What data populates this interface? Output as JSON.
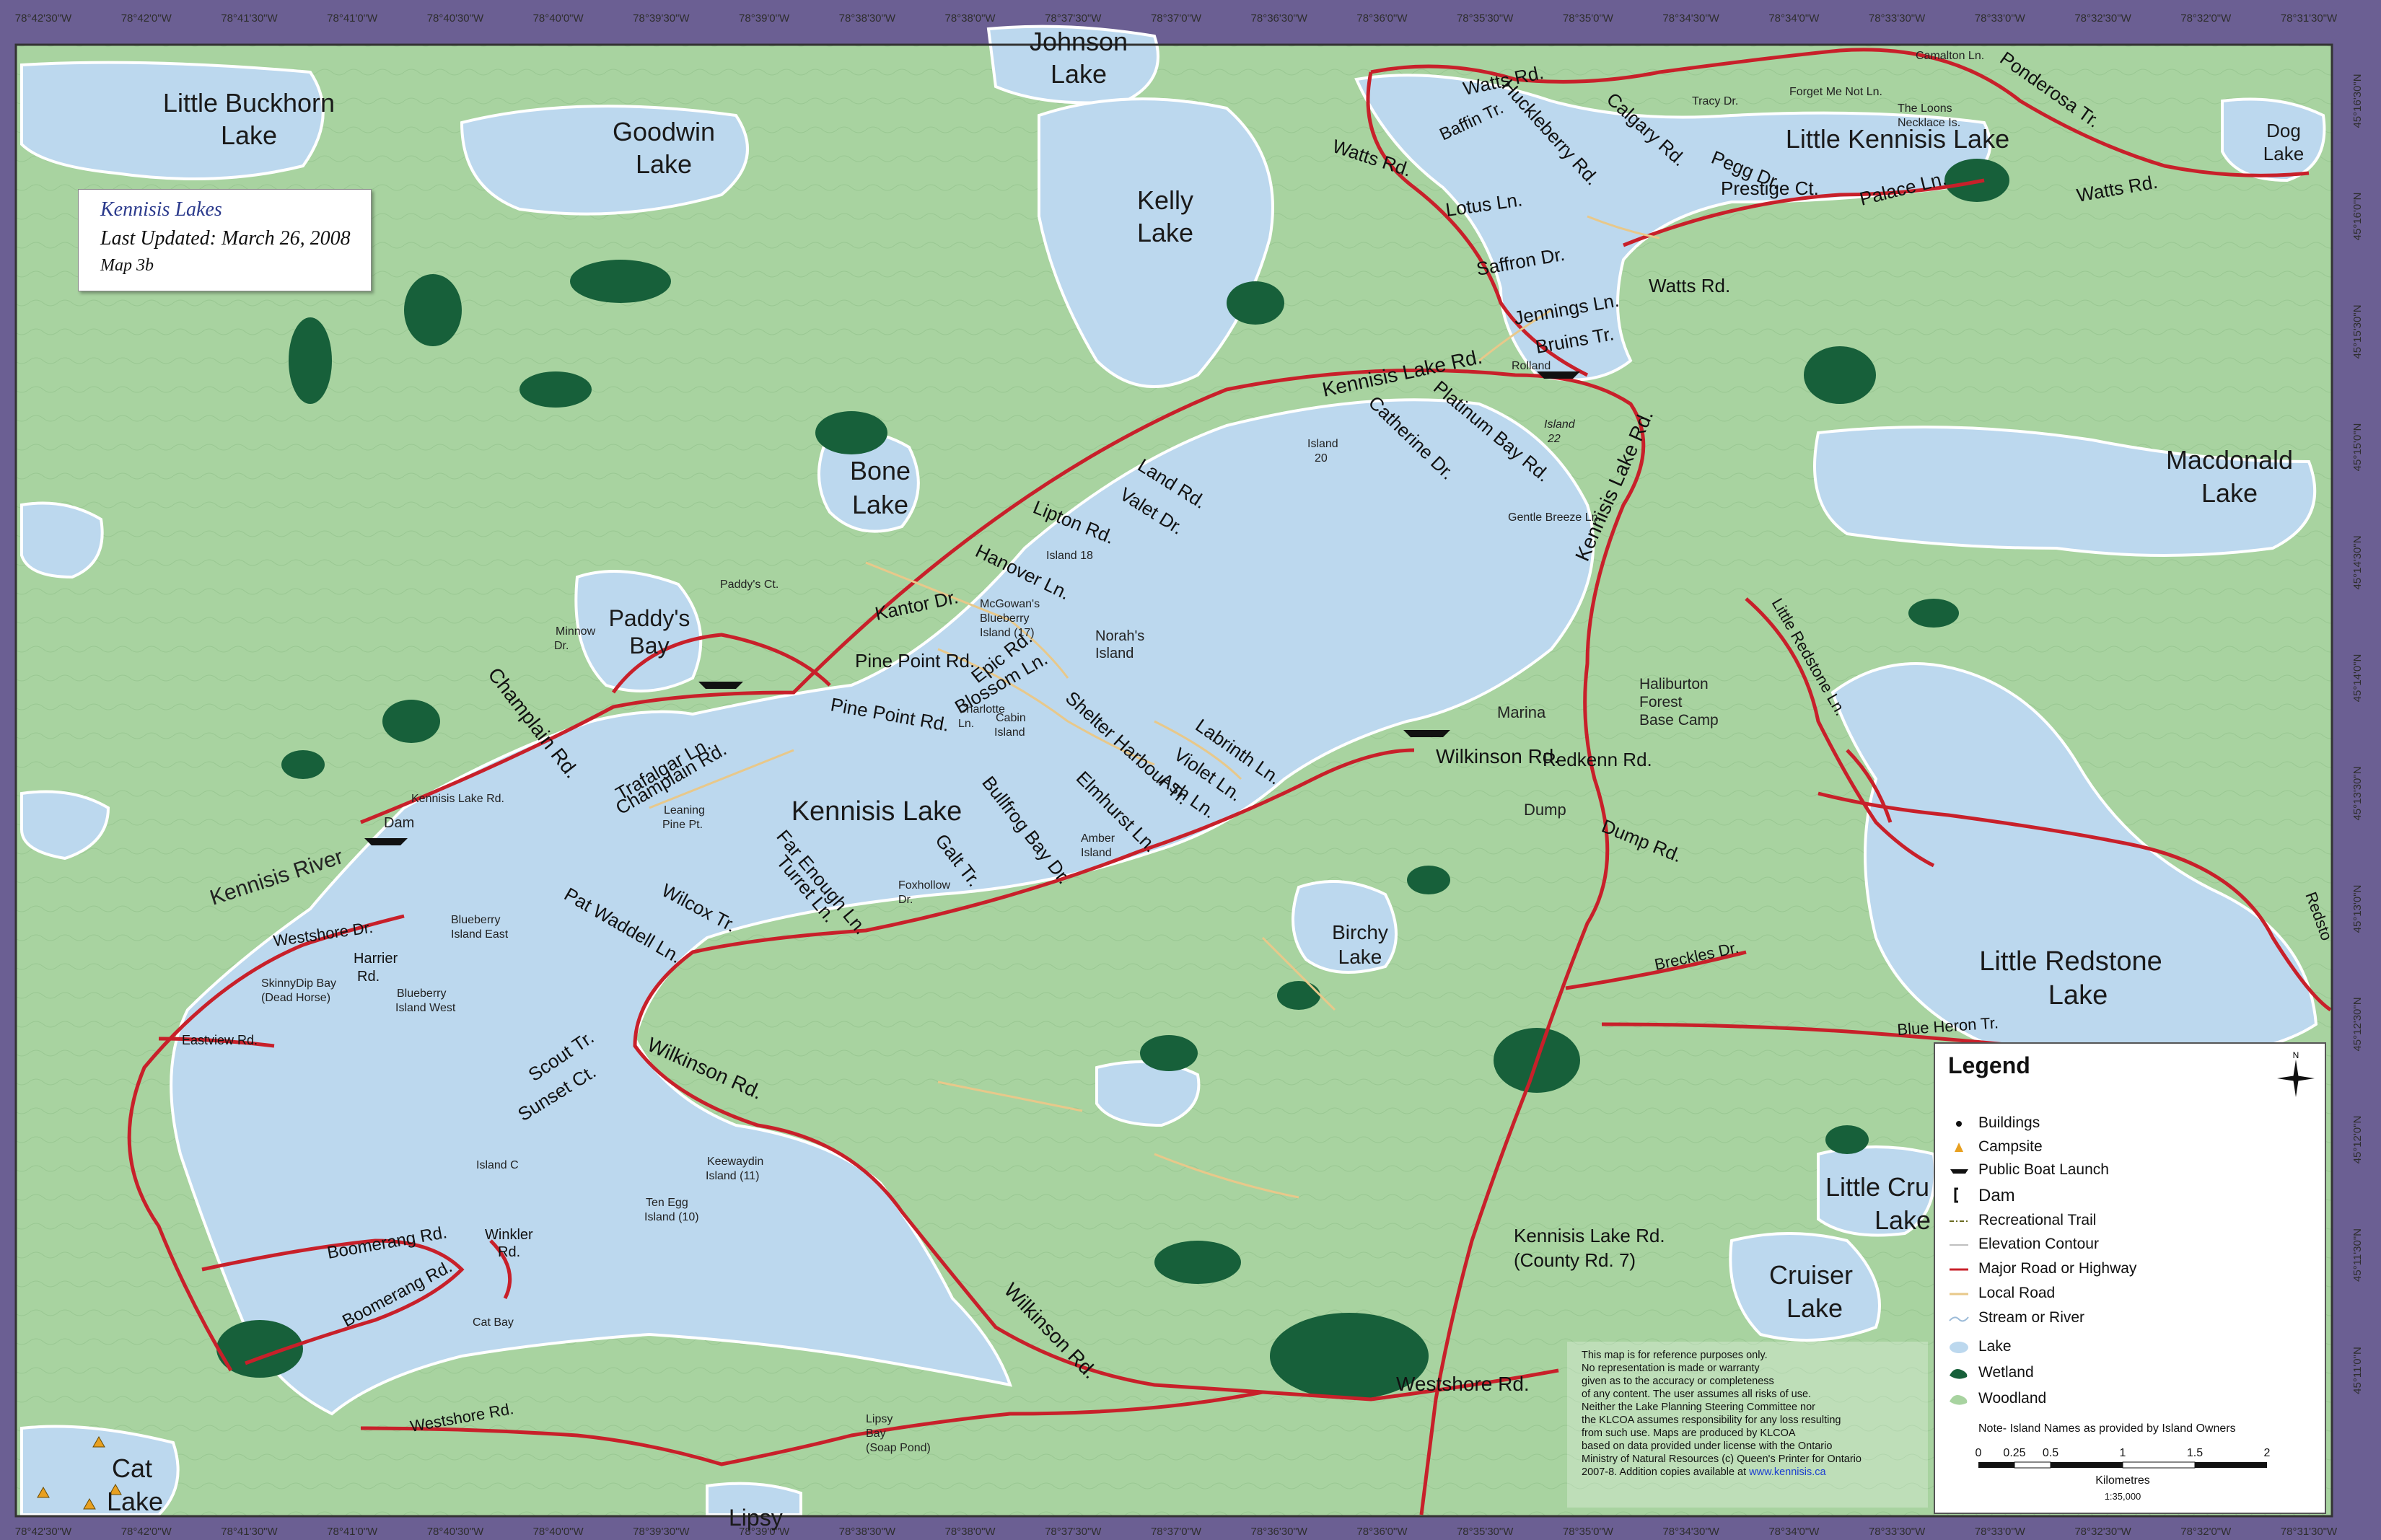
{
  "title_box": {
    "title": "Kennisis Lakes",
    "updated": "Last Updated: March 26, 2008",
    "map_no": "Map 3b"
  },
  "top_coords": [
    "78°42'30\"W",
    "78°42'0\"W",
    "78°41'30\"W",
    "78°41'0\"W",
    "78°40'30\"W",
    "78°40'0\"W",
    "78°39'30\"W",
    "78°39'0\"W",
    "78°38'30\"W",
    "78°38'0\"W",
    "78°37'30\"W",
    "78°37'0\"W",
    "78°36'30\"W",
    "78°36'0\"W",
    "78°35'30\"W",
    "78°35'0\"W",
    "78°34'30\"W",
    "78°34'0\"W",
    "78°33'30\"W",
    "78°33'0\"W",
    "78°32'30\"W",
    "78°32'0\"W",
    "78°31'30\"W"
  ],
  "right_coords": [
    "45°16'30\"N",
    "45°16'0\"N",
    "45°15'30\"N",
    "45°15'0\"N",
    "45°14'30\"N",
    "45°14'0\"N",
    "45°13'30\"N",
    "45°13'0\"N",
    "45°12'30\"N",
    "45°12'0\"N",
    "45°11'30\"N",
    "45°11'0\"N"
  ],
  "lakes": {
    "little_buckhorn": [
      "Little Buckhorn",
      "Lake"
    ],
    "goodwin": [
      "Goodwin",
      "Lake"
    ],
    "johnson": [
      "Johnson",
      "Lake"
    ],
    "kelly": [
      "Kelly",
      "Lake"
    ],
    "bone": [
      "Bone",
      "Lake"
    ],
    "paddys_bay": [
      "Paddy's",
      "Bay"
    ],
    "kennisis": "Kennisis Lake",
    "little_kennisis": "Little Kennisis Lake",
    "dog": [
      "Dog",
      "Lake"
    ],
    "macdonald": [
      "Macdonald",
      "Lake"
    ],
    "little_redstone": [
      "Little Redstone",
      "Lake"
    ],
    "birchy": [
      "Birchy",
      "Lake"
    ],
    "cruiser": [
      "Cruiser",
      "Lake"
    ],
    "little_cruiser": [
      "Little Cru",
      "Lake"
    ],
    "cat": [
      "Cat",
      "Lake"
    ],
    "lipsy": "Lipsy"
  },
  "roads": {
    "watts1": "Watts Rd.",
    "watts2": "Watts Rd.",
    "watts3": "Watts Rd.",
    "watts4": "Watts Rd.",
    "huckleberry": "Huckleberry Rd.",
    "calgary": "Calgary Rd.",
    "baffin": "Baffin Tr.",
    "pegg": "Pegg Dr.",
    "prestige": "Prestige Ct.",
    "palace": "Palace Ln.",
    "ponderosa": "Ponderosa Tr.",
    "lotus": "Lotus Ln.",
    "saffron": "Saffron Dr.",
    "jennings": "Jennings Ln.",
    "bruins": "Bruins Tr.",
    "kennisis_lake_rd": "Kennisis Lake Rd.",
    "kennisis_lake_rd2": "Kennisis Lake Rd.",
    "platinum": "Platinum Bay Rd.",
    "catherine": "Catherine Dr.",
    "land": "Land Rd.",
    "valet": "Valet Dr.",
    "lipton": "Lipton Rd.",
    "hanover": "Hanover Ln.",
    "kantor": "Kantor Dr.",
    "pine_point1": "Pine Point Rd.",
    "pine_point2": "Pine Point Rd.",
    "epic": "Epic Rd.",
    "blossom": "Blossom Ln.",
    "shelter": "Shelter Harbour Tr.",
    "labrinth": "Labrinth Ln.",
    "violet": "Violet Ln.",
    "ash": "Ash Ln.",
    "elmhurst": "Elmhurst Ln.",
    "wilkinson1": "Wilkinson Rd.",
    "wilkinson2": "Wilkinson Rd.",
    "wilkinson3": "Wilkinson Rd.",
    "redkenn": "Redkenn Rd.",
    "dump_rd": "Dump Rd.",
    "champlain1": "Champlain Rd.",
    "champlain2": "Champlain Rd.",
    "trafalgar": "Trafalgar Ln.",
    "bullfrog": "Bullfrog Bay Dr.",
    "galt": "Galt Tr.",
    "far_enough": "Far Enough Ln.",
    "turret": "Turret Ln.",
    "wilcox": "Wilcox Tr.",
    "pat_waddell": "Pat Waddell Ln.",
    "scout": "Scout Tr.",
    "sunset": "Sunset Ct.",
    "boomerang1": "Boomerang Rd.",
    "boomerang2": "Boomerang Rd.",
    "westshore1": "Westshore Dr.",
    "westshore2": "Westshore Rd.",
    "westshore3": "Westshore Rd.",
    "breckles": "Breckles Dr.",
    "blue_heron": "Blue Heron Tr.",
    "little_redstone_ln": "Little Redstone Ln.",
    "county": [
      "Kennisis Lake Rd.",
      "(County Rd. 7)"
    ],
    "winkler": [
      "Winkler",
      "Rd."
    ],
    "harrier": [
      "Harrier",
      "Rd."
    ],
    "eastview": "Eastview Rd.",
    "redstone_partial": "Redsto"
  },
  "small_labels": {
    "camalton": "Camalton Ln.",
    "tracy": "Tracy Dr.",
    "forget": "Forget Me Not Ln.",
    "loons": [
      "The Loons",
      "Necklace Is."
    ],
    "rolland": "Rolland",
    "island22": [
      "Island",
      "22"
    ],
    "island20": [
      "Island",
      "20"
    ],
    "gentle": "Gentle Breeze Ln.",
    "island18": "Island 18",
    "mcgowans": [
      "McGowan's",
      "Blueberry",
      "Island (17)"
    ],
    "norahs": [
      "Norah's",
      "Island"
    ],
    "paddys_ct": "Paddy's Ct.",
    "minnow": [
      "Minnow",
      "Dr."
    ],
    "charlotte": [
      "Charlotte",
      "Ln."
    ],
    "cabin": [
      "Cabin",
      "Island"
    ],
    "marina": "Marina",
    "haliburton": [
      "Haliburton",
      "Forest",
      "Base Camp"
    ],
    "dump": "Dump",
    "kl_rd_small": "Kennisis Lake Rd.",
    "dam": "Dam",
    "kennisis_river": "Kennisis River",
    "leaning": [
      "Leaning",
      "Pine Pt."
    ],
    "amber": [
      "Amber",
      "Island"
    ],
    "foxhollow": [
      "Foxhollow",
      "Dr."
    ],
    "blueberry_east": [
      "Blueberry",
      "Island East"
    ],
    "blueberry_west": [
      "Blueberry",
      "Island West"
    ],
    "skinnydip": [
      "SkinnyDip Bay",
      "(Dead Horse)"
    ],
    "island_c": "Island C",
    "keewaydin": [
      "Keewaydin",
      "Island (11)"
    ],
    "ten_egg": [
      "Ten Egg",
      "Island (10)"
    ],
    "cat_bay": "Cat Bay",
    "lipsy_bay": [
      "Lipsy",
      "Bay",
      "(Soap Pond)"
    ]
  },
  "legend": {
    "title": "Legend",
    "items": [
      "Buildings",
      "Campsite",
      "Public Boat Launch",
      "Dam",
      "Recreational Trail",
      "Elevation Contour",
      "Major Road or Highway",
      "Local Road",
      "Stream or River",
      "Lake",
      "Wetland",
      "Woodland"
    ],
    "note": "Note- Island Names as provided by Island Owners",
    "scale_ticks": [
      "0",
      "0.25",
      "0.5",
      "1",
      "1.5",
      "2"
    ],
    "scale_unit": "Kilometres",
    "scale_ratio": "1:35,000",
    "north": "N"
  },
  "disclaimer": [
    "This map is for reference purposes only.",
    "No representation is made or warranty",
    "given as to the accuracy or completeness",
    "of any content. The user assumes all risks of use.",
    "Neither the Lake Planning Steering Committee nor",
    "the KLCOA assumes responsibility for any loss resulting",
    "from such use.  Maps are produced by KLCOA",
    "based on data provided under license with the Ontario",
    "Ministry of Natural Resources (c) Queen's Printer for Ontario",
    "2007-8.  Addition copies available at"
  ],
  "disclaimer_url": "www.kennisis.ca",
  "colors": {
    "land": "#a8d3a0",
    "water": "#bcd8ee",
    "wetland": "#17603a",
    "major_road": "#c8202a",
    "local_road": "#e8c88a",
    "frame": "#6b5f93"
  }
}
